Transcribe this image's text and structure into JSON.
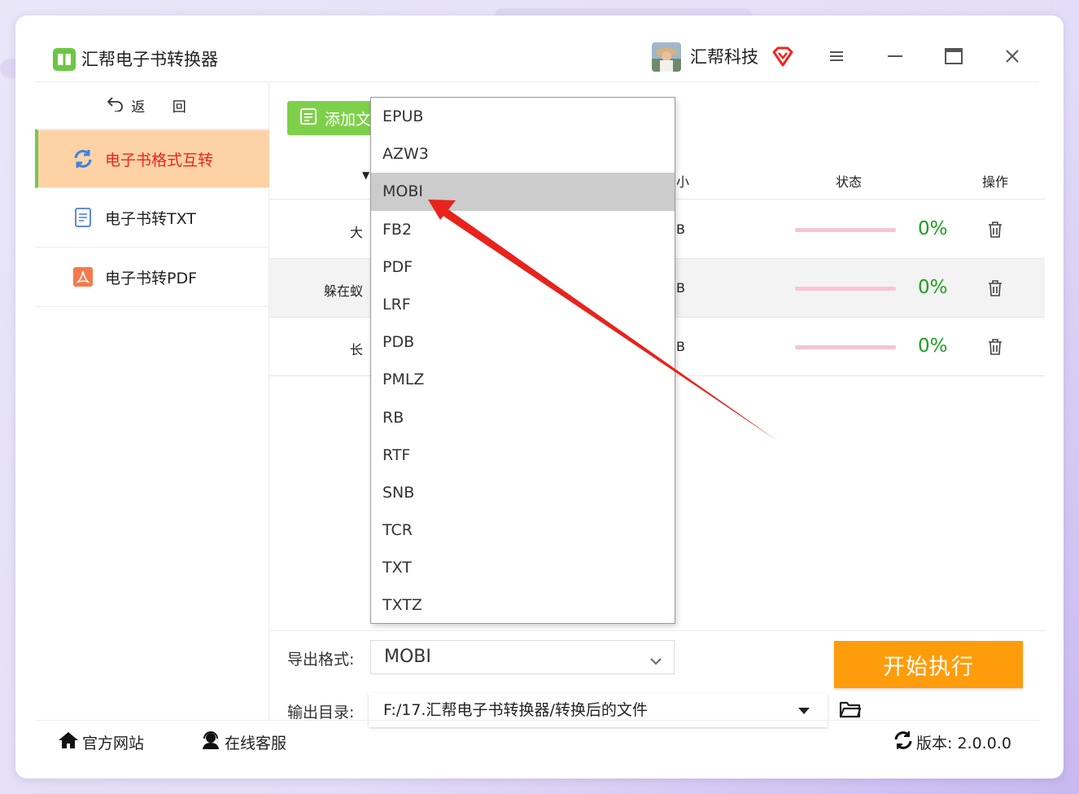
{
  "app": {
    "title": "汇帮电子书转换器",
    "brand_name": "汇帮科技"
  },
  "sidebar": {
    "back_label": "返 回",
    "items": [
      {
        "label": "电子书格式互转",
        "active": true
      },
      {
        "label": "电子书转TXT",
        "active": false
      },
      {
        "label": "电子书转PDF",
        "active": false
      }
    ]
  },
  "toolbar": {
    "add_label": "添加文"
  },
  "table": {
    "headers": {
      "sort": "▼",
      "size": "小",
      "status": "状态",
      "actions": "操作"
    },
    "rows": [
      {
        "name": "大",
        "size": "B",
        "progress": "0%"
      },
      {
        "name": "躲在蚁",
        "size": "B",
        "progress": "0%"
      },
      {
        "name": "长",
        "size": "B",
        "progress": "0%"
      }
    ]
  },
  "format_dropdown": {
    "options": [
      "EPUB",
      "AZW3",
      "MOBI",
      "FB2",
      "PDF",
      "LRF",
      "PDB",
      "PMLZ",
      "RB",
      "RTF",
      "SNB",
      "TCR",
      "TXT",
      "TXTZ"
    ],
    "highlighted": "MOBI"
  },
  "settings": {
    "format_label": "导出格式:",
    "format_value": "MOBI",
    "output_label": "输出目录:",
    "output_path": "F:/17.汇帮电子书转换器/转换后的文件",
    "start_label": "开始执行"
  },
  "bottom": {
    "website": "官方网站",
    "support": "在线客服",
    "version": "版本: 2.0.0.0"
  },
  "colors": {
    "accent_green": "#7ed04a",
    "active_bg": "#fdd3a6",
    "active_text": "#f2241b",
    "start_orange": "#ff9c0b",
    "progress_green": "#1e9e1e",
    "arrow_red": "#e8231c"
  }
}
